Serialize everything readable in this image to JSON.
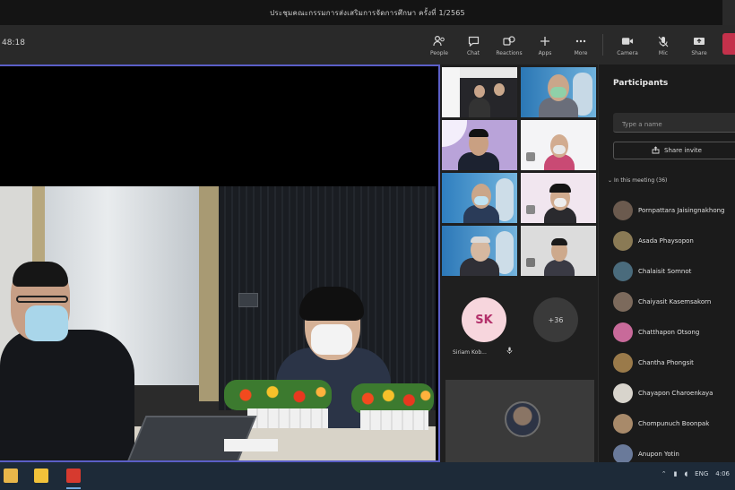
{
  "window": {
    "title": "ประชุมคณะกรรมการส่งเสริมการจัดการศึกษา ครั้งที่ 1/2565"
  },
  "toolbar": {
    "timer": "48:18",
    "buttons": [
      {
        "label": "People",
        "icon": "people-icon"
      },
      {
        "label": "Chat",
        "icon": "chat-icon"
      },
      {
        "label": "Reactions",
        "icon": "reactions-icon"
      },
      {
        "label": "Apps",
        "icon": "apps-icon"
      },
      {
        "label": "More",
        "icon": "more-icon"
      },
      {
        "label": "Camera",
        "icon": "camera-icon"
      },
      {
        "label": "Mic",
        "icon": "mic-icon"
      },
      {
        "label": "Share",
        "icon": "share-icon"
      }
    ]
  },
  "gallery": {
    "sk_initials": "SK",
    "sk_name": "Siriam Kob...",
    "more_count": "+36"
  },
  "participants_panel": {
    "title": "Participants",
    "search_placeholder": "Type a name",
    "share_invite_label": "Share invite",
    "section_label": "In this meeting (36)",
    "people": [
      {
        "name": "Pornpattara Jaisingnakhong",
        "color": "#6b5a4e"
      },
      {
        "name": "Asada Phaysopon",
        "color": "#8a7a55"
      },
      {
        "name": "Chalaisit Somnot",
        "color": "#4a6b7c"
      },
      {
        "name": "Chaiyasit Kasemsakorn",
        "color": "#7c6a5c"
      },
      {
        "name": "Chatthapon Otsong",
        "color": "#c86a9a"
      },
      {
        "name": "Chantha Phongsit",
        "color": "#9a7a4a"
      },
      {
        "name": "Chayapon Charoenkaya",
        "color": "#d8d4cc"
      },
      {
        "name": "Chompunuch Boonpak",
        "color": "#a88a6a"
      },
      {
        "name": "Anupon Yotin",
        "color": "#6a7a9a"
      }
    ]
  },
  "taskbar": {
    "lang": "ENG",
    "clock": "4:06"
  }
}
